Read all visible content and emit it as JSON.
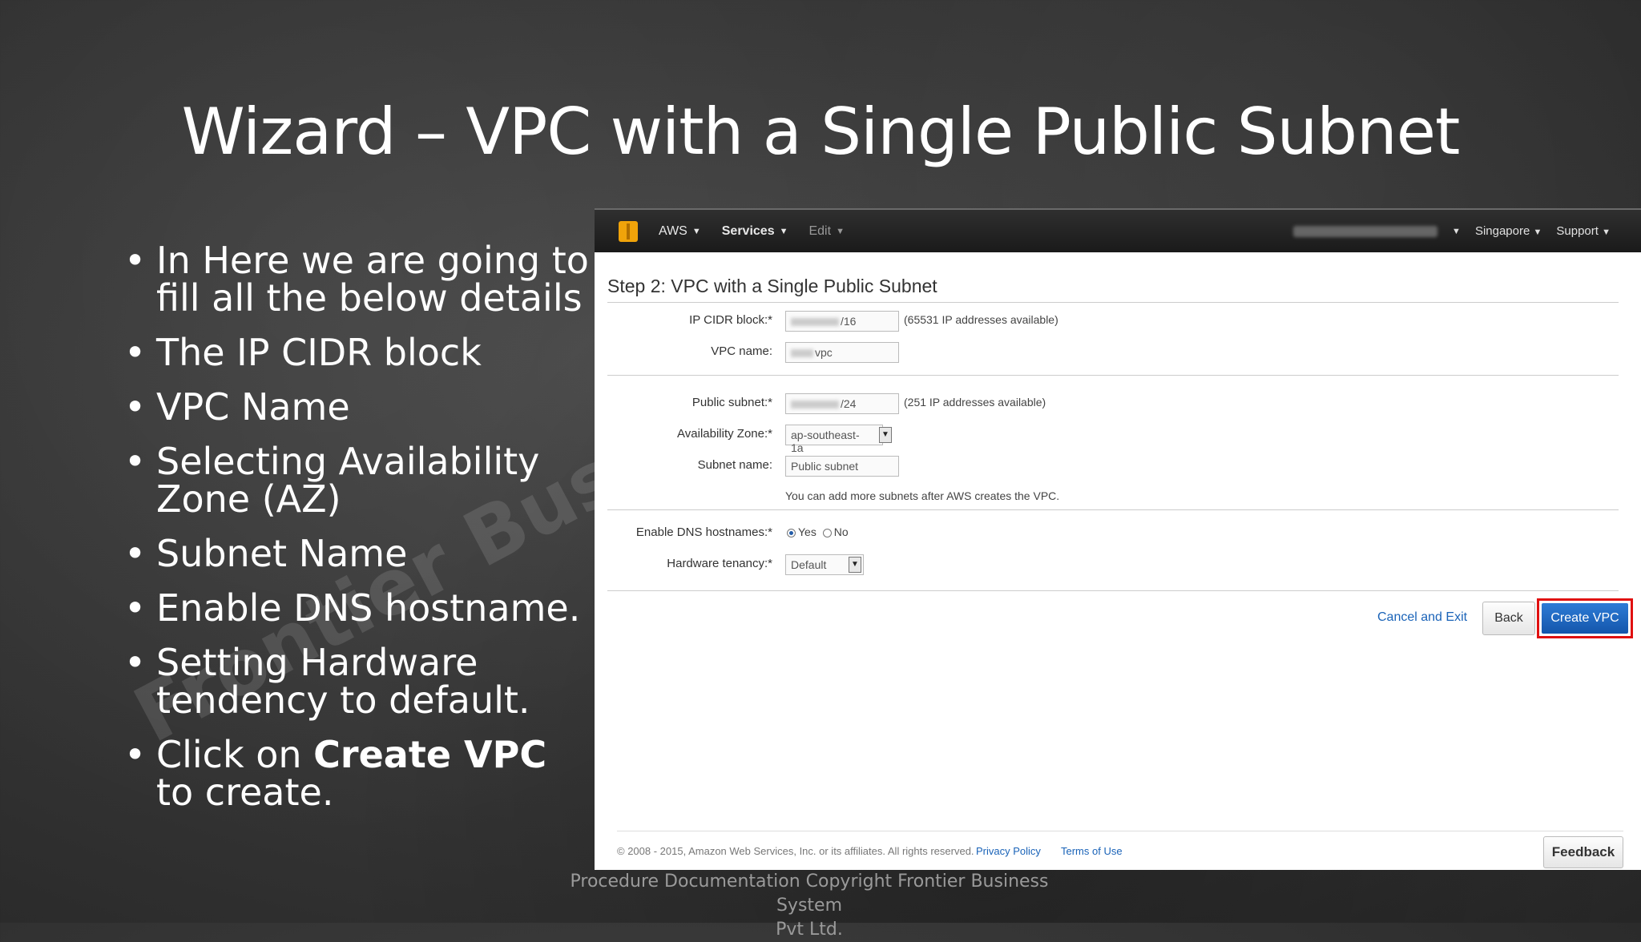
{
  "slide": {
    "title": "Wizard – VPC with a Single Public Subnet",
    "bullets": [
      "In Here we are going to fill all the below details",
      "The IP CIDR block",
      "VPC Name",
      "Selecting Availability Zone (AZ)",
      "Subnet Name",
      "Enable DNS hostname.",
      "Setting Hardware tendency to default."
    ],
    "last_bullet": {
      "pre": "Click on ",
      "bold": "Create VPC",
      "post": " to create."
    },
    "watermark": "Frontier Busi",
    "footer_line1": "Procedure Documentation Copyright Frontier Business System",
    "footer_line2": "Pvt Ltd."
  },
  "console": {
    "topbar": {
      "aws": "AWS",
      "services": "Services",
      "edit": "Edit",
      "region": "Singapore",
      "support": "Support"
    },
    "step_title": "Step 2: VPC with a Single Public Subnet",
    "fields": {
      "cidr_label": "IP CIDR block:*",
      "cidr_value": "/16",
      "cidr_hint": "(65531 IP addresses available)",
      "vpc_label": "VPC name:",
      "vpc_value": "vpc",
      "subnet_label": "Public subnet:*",
      "subnet_value": "/24",
      "subnet_hint": "(251 IP addresses available)",
      "az_label": "Availability Zone:*",
      "az_value": "ap-southeast-1a",
      "subnet_name_label": "Subnet name:",
      "subnet_name_value": "Public subnet",
      "subnet_note": "You can add more subnets after AWS creates the VPC.",
      "dns_label": "Enable DNS hostnames:*",
      "dns_yes": "Yes",
      "dns_no": "No",
      "tenancy_label": "Hardware tenancy:*",
      "tenancy_value": "Default"
    },
    "actions": {
      "cancel": "Cancel and Exit",
      "back": "Back",
      "create": "Create VPC"
    },
    "footer": {
      "copyright": "© 2008 - 2015, Amazon Web Services, Inc. or its affiliates. All rights reserved.",
      "privacy": "Privacy Policy",
      "terms": "Terms of Use",
      "feedback": "Feedback"
    }
  }
}
